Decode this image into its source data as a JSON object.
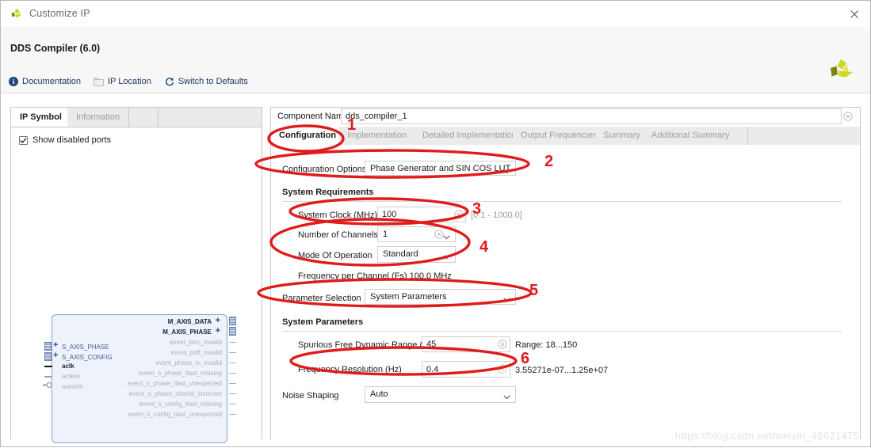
{
  "window": {
    "title": "Customize IP",
    "close_label": "×",
    "logo_name": "xilinx-logo"
  },
  "header": {
    "ip_title": "DDS Compiler (6.0)",
    "toolbar": [
      {
        "label": "Documentation",
        "icon": "info-icon"
      },
      {
        "label": "IP Location",
        "icon": "folder-icon"
      },
      {
        "label": "Switch to Defaults",
        "icon": "refresh-icon"
      }
    ]
  },
  "left_panel": {
    "tabs": [
      {
        "label": "IP Symbol",
        "active": true
      },
      {
        "label": "Information",
        "active": false
      }
    ],
    "show_disabled_ports": {
      "label": "Show disabled ports",
      "checked": true
    },
    "symbol": {
      "left_ports": [
        {
          "name": "S_AXIS_PHASE",
          "type": "bus",
          "enabled": false
        },
        {
          "name": "S_AXIS_CONFIG",
          "type": "bus",
          "enabled": false
        },
        {
          "name": "aclk",
          "type": "pin",
          "enabled": true
        },
        {
          "name": "aclken",
          "type": "pin",
          "enabled": false
        },
        {
          "name": "aresetn",
          "type": "pin-inverted",
          "enabled": false
        }
      ],
      "right_ports": [
        {
          "name": "M_AXIS_DATA",
          "type": "bus",
          "enabled": true
        },
        {
          "name": "M_AXIS_PHASE",
          "type": "bus",
          "enabled": true
        },
        {
          "name": "event_pinc_invalid",
          "type": "pin",
          "enabled": false
        },
        {
          "name": "event_poff_invalid",
          "type": "pin",
          "enabled": false
        },
        {
          "name": "event_phase_in_invalid",
          "type": "pin",
          "enabled": false
        },
        {
          "name": "event_s_phase_tlast_missing",
          "type": "pin",
          "enabled": false
        },
        {
          "name": "event_s_phase_tlast_unexpected",
          "type": "pin",
          "enabled": false
        },
        {
          "name": "event_s_phase_chanid_incorrect",
          "type": "pin",
          "enabled": false
        },
        {
          "name": "event_s_config_tlast_missing",
          "type": "pin",
          "enabled": false
        },
        {
          "name": "event_s_config_tlast_unexpected",
          "type": "pin",
          "enabled": false
        }
      ]
    }
  },
  "right_panel": {
    "component_name": {
      "label": "Component Name",
      "value": "dds_compiler_1"
    },
    "tabs": [
      {
        "label": "Configuration",
        "active": true
      },
      {
        "label": "Implementation",
        "active": false
      },
      {
        "label": "Detailed Implementation",
        "active": false
      },
      {
        "label": "Output Frequencies",
        "active": false
      },
      {
        "label": "Summary",
        "active": false
      },
      {
        "label": "Additional Summary",
        "active": false
      }
    ],
    "configuration_options": {
      "label": "Configuration Options",
      "value": "Phase Generator and SIN COS LUT"
    },
    "system_requirements": {
      "title": "System Requirements",
      "system_clock": {
        "label": "System Clock (MHz)",
        "value": "100",
        "range": "[0.1 - 1000.0]"
      },
      "number_of_channels": {
        "label": "Number of Channels",
        "value": "1"
      },
      "mode_of_operation": {
        "label": "Mode Of Operation",
        "value": "Standard"
      },
      "frequency_per_channel": "Frequency per Channel (Fs) 100.0 MHz",
      "parameter_selection": {
        "label": "Parameter Selection",
        "value": "System Parameters"
      }
    },
    "system_parameters": {
      "title": "System Parameters",
      "sfdr": {
        "label": "Spurious Free Dynamic Range (dB)",
        "value": "45",
        "range": "Range: 18...150"
      },
      "frequency_resolution": {
        "label": "Frequency Resolution (Hz)",
        "value": "0.4",
        "range": "3.55271e-07...1.25e+07"
      },
      "noise_shaping": {
        "label": "Noise Shaping",
        "value": "Auto"
      }
    }
  },
  "annotations": {
    "color": "#e01b1b",
    "marks": [
      {
        "number": "1",
        "target": "configuration-tab"
      },
      {
        "number": "2",
        "target": "configuration-options-combo"
      },
      {
        "number": "3",
        "target": "system-clock-field"
      },
      {
        "number": "4",
        "target": "channels-and-mode-fields"
      },
      {
        "number": "5",
        "target": "parameter-selection-combo"
      },
      {
        "number": "6",
        "target": "frequency-resolution-field"
      }
    ]
  },
  "watermark": "https://blog.csdn.net/weixin_42621475"
}
